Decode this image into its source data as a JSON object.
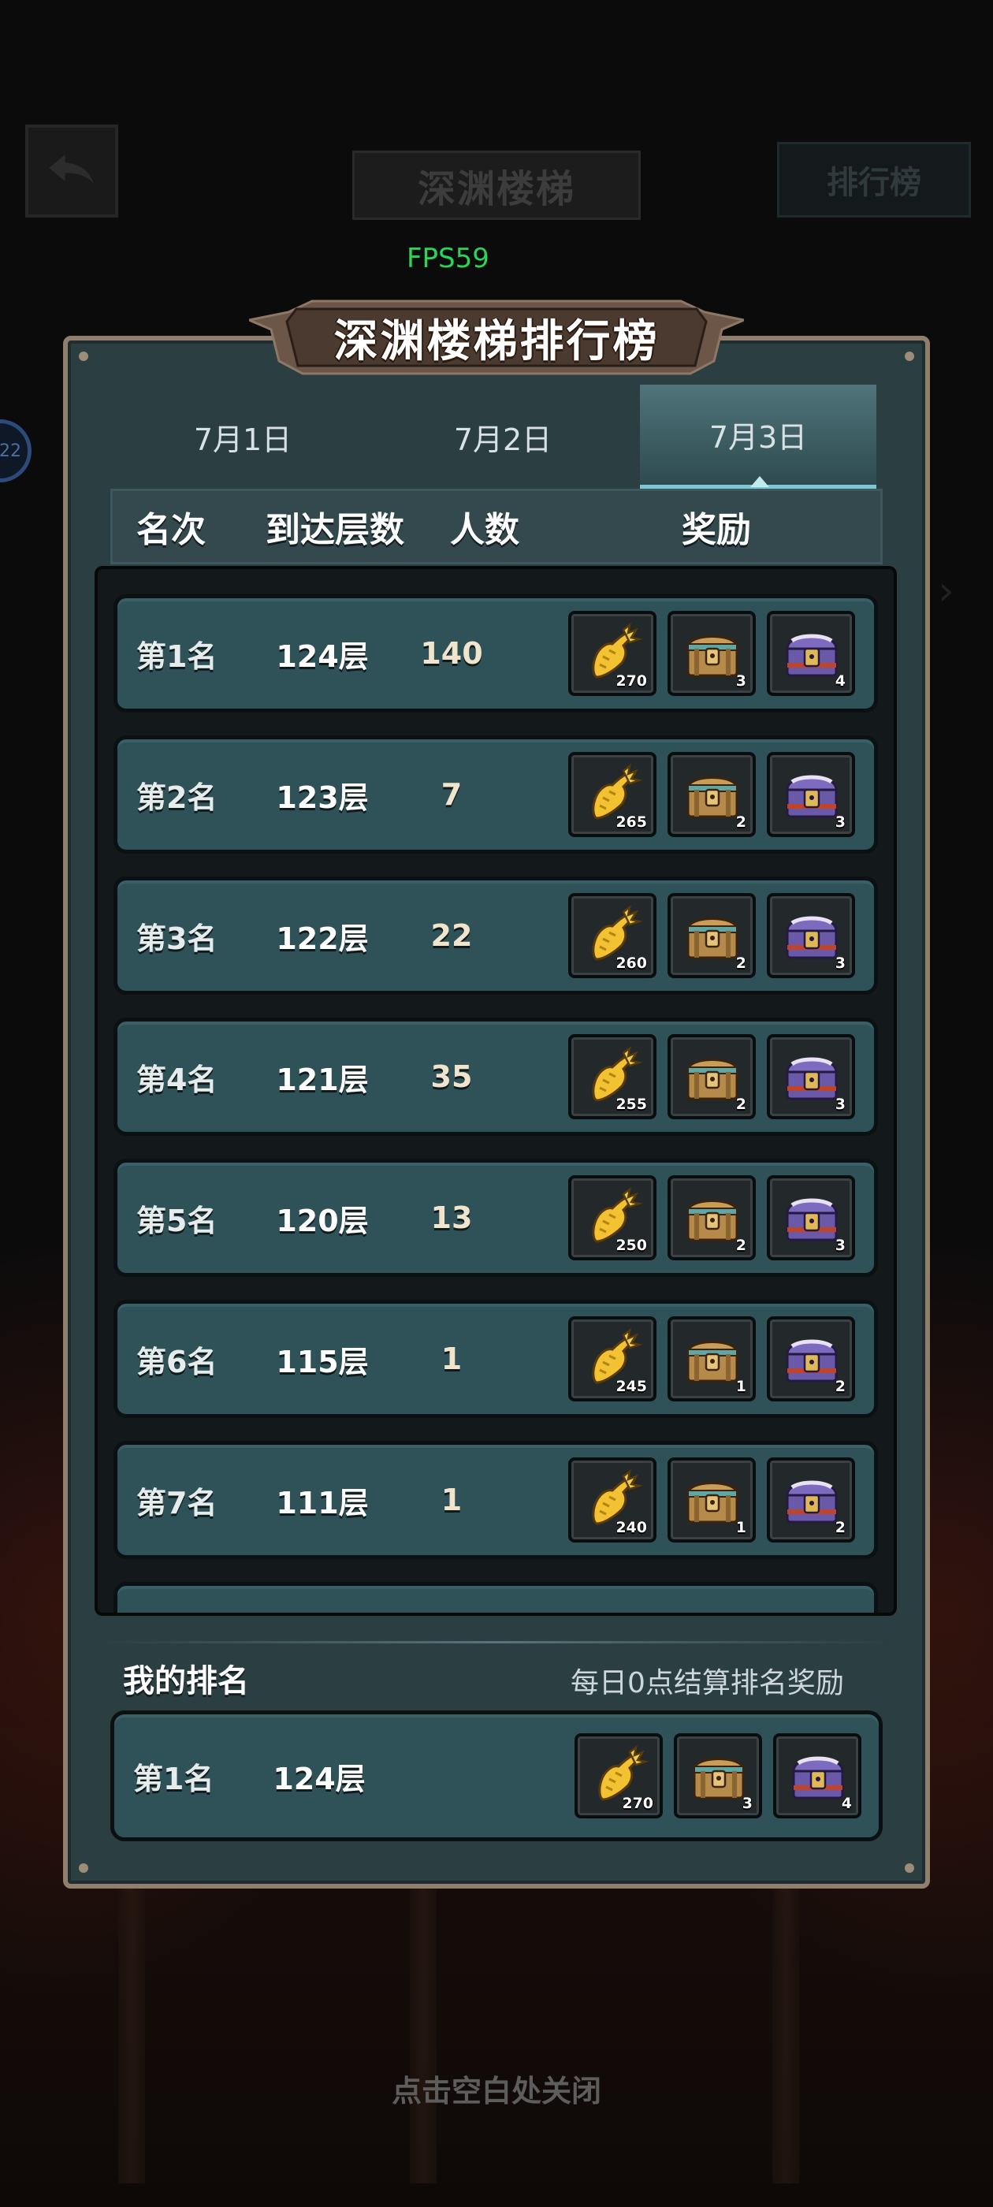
{
  "background": {
    "title": "深渊楼梯",
    "rank_button": "排行榜",
    "fps": "FPS59",
    "side_badge": "22"
  },
  "panel": {
    "title": "深渊楼梯排行榜",
    "tabs": [
      {
        "label": "7月1日",
        "active": false
      },
      {
        "label": "7月2日",
        "active": false
      },
      {
        "label": "7月3日",
        "active": true
      }
    ],
    "headers": {
      "rank": "名次",
      "floor": "到达层数",
      "count": "人数",
      "reward": "奖励"
    },
    "rows": [
      {
        "rank": "第1名",
        "floor": "124层",
        "count": "140",
        "rewards": [
          {
            "icon": "golden-carrot-icon",
            "qty": "270"
          },
          {
            "icon": "bronze-chest-icon",
            "qty": "3"
          },
          {
            "icon": "purple-chest-icon",
            "qty": "4"
          }
        ]
      },
      {
        "rank": "第2名",
        "floor": "123层",
        "count": "7",
        "rewards": [
          {
            "icon": "golden-carrot-icon",
            "qty": "265"
          },
          {
            "icon": "bronze-chest-icon",
            "qty": "2"
          },
          {
            "icon": "purple-chest-icon",
            "qty": "3"
          }
        ]
      },
      {
        "rank": "第3名",
        "floor": "122层",
        "count": "22",
        "rewards": [
          {
            "icon": "golden-carrot-icon",
            "qty": "260"
          },
          {
            "icon": "bronze-chest-icon",
            "qty": "2"
          },
          {
            "icon": "purple-chest-icon",
            "qty": "3"
          }
        ]
      },
      {
        "rank": "第4名",
        "floor": "121层",
        "count": "35",
        "rewards": [
          {
            "icon": "golden-carrot-icon",
            "qty": "255"
          },
          {
            "icon": "bronze-chest-icon",
            "qty": "2"
          },
          {
            "icon": "purple-chest-icon",
            "qty": "3"
          }
        ]
      },
      {
        "rank": "第5名",
        "floor": "120层",
        "count": "13",
        "rewards": [
          {
            "icon": "golden-carrot-icon",
            "qty": "250"
          },
          {
            "icon": "bronze-chest-icon",
            "qty": "2"
          },
          {
            "icon": "purple-chest-icon",
            "qty": "3"
          }
        ]
      },
      {
        "rank": "第6名",
        "floor": "115层",
        "count": "1",
        "rewards": [
          {
            "icon": "golden-carrot-icon",
            "qty": "245"
          },
          {
            "icon": "bronze-chest-icon",
            "qty": "1"
          },
          {
            "icon": "purple-chest-icon",
            "qty": "2"
          }
        ]
      },
      {
        "rank": "第7名",
        "floor": "111层",
        "count": "1",
        "rewards": [
          {
            "icon": "golden-carrot-icon",
            "qty": "240"
          },
          {
            "icon": "bronze-chest-icon",
            "qty": "1"
          },
          {
            "icon": "purple-chest-icon",
            "qty": "2"
          }
        ]
      }
    ],
    "my_rank": {
      "title": "我的排名",
      "note": "每日0点结算排名奖励",
      "rank": "第1名",
      "floor": "124层",
      "rewards": [
        {
          "icon": "golden-carrot-icon",
          "qty": "270"
        },
        {
          "icon": "bronze-chest-icon",
          "qty": "3"
        },
        {
          "icon": "purple-chest-icon",
          "qty": "4"
        }
      ]
    }
  },
  "close_hint": "点击空白处关闭",
  "colors": {
    "panel": "#2b3e42",
    "row": "#2f5158",
    "frame": "#8f7f6c",
    "tab_active": "#4f747a",
    "fps": "#2bd457"
  }
}
